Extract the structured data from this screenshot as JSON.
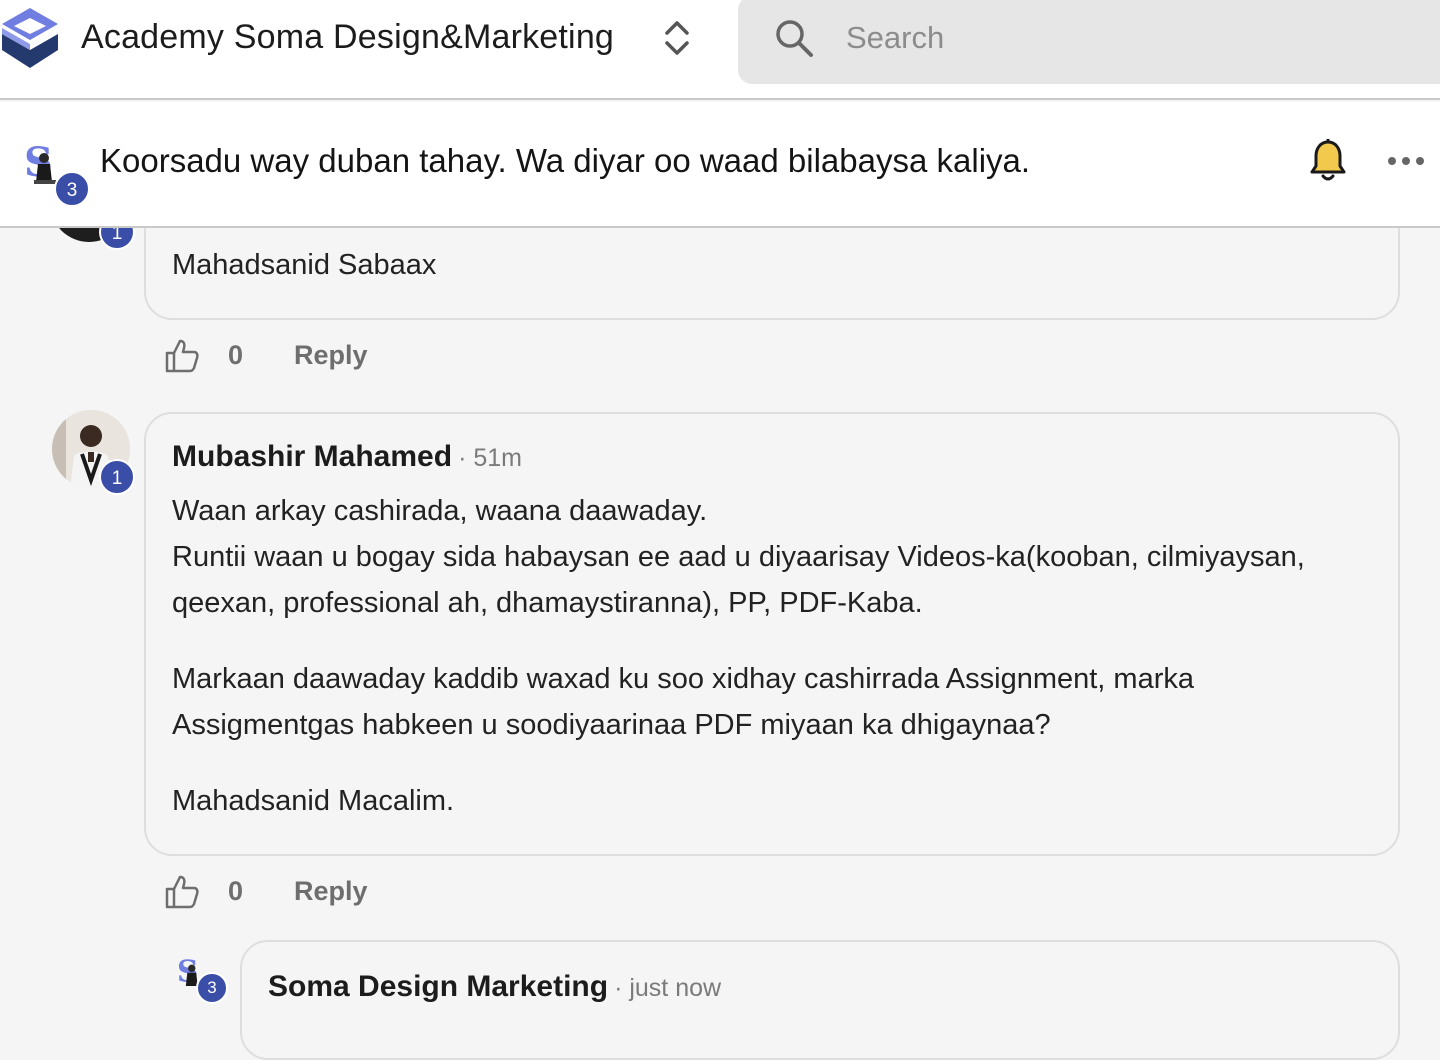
{
  "header": {
    "org_name": "Academy Soma Design&Marketing",
    "search_placeholder": "Search"
  },
  "post": {
    "title": "Koorsadu way duban tahay. Wa diyar oo waad bilabaysa kaliya.",
    "author_badge": "3"
  },
  "comments": [
    {
      "badge": "1",
      "text": "Mahadsanid Sabaax",
      "likes": "0",
      "reply_label": "Reply"
    },
    {
      "author": "Mubashir Mahamed",
      "time": "· 51m",
      "badge": "1",
      "lines": [
        "Waan arkay cashirada, waana daawaday.",
        "Runtii waan u bogay sida habaysan ee aad u diyaarisay Videos-ka(kooban, cilmiyaysan,",
        "qeexan, professional ah, dhamaystiranna), PP, PDF-Kaba.",
        "Markaan daawaday kaddib waxad ku soo xidhay cashirrada Assignment, marka",
        "Assigmentgas habkeen u soodiyaarinaa PDF miyaan ka dhigaynaa?",
        "Mahadsanid Macalim."
      ],
      "likes": "0",
      "reply_label": "Reply"
    },
    {
      "author": "Soma Design Marketing",
      "time": "· just now",
      "badge": "3"
    }
  ],
  "colors": {
    "badge": "#3a4ea8",
    "logo_light": "#6f7ee0",
    "logo_dark": "#243a6e",
    "bell": "#f2c94c"
  },
  "icons": [
    "logo-icon",
    "chevron-updown-icon",
    "search-icon",
    "bell-icon",
    "more-icon",
    "thumbs-up-icon"
  ]
}
